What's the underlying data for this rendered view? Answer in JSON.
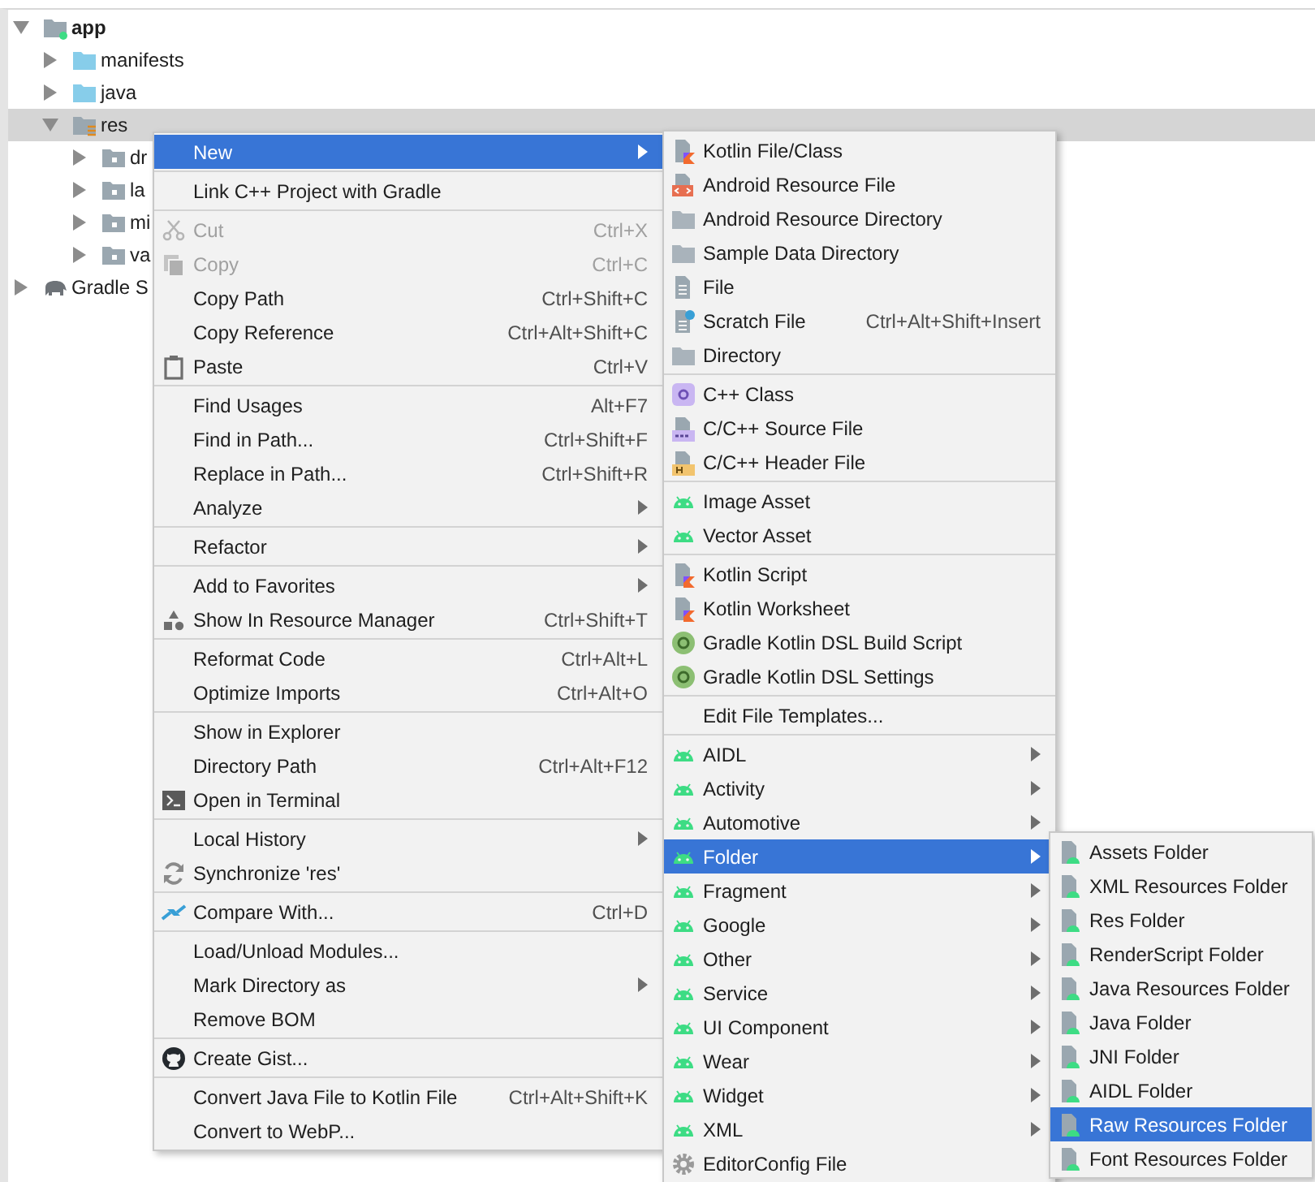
{
  "tree": [
    {
      "label": "app",
      "kind": "module",
      "expanded": true,
      "selected": false,
      "children": [
        {
          "label": "manifests",
          "kind": "source",
          "expanded": false,
          "selected": false
        },
        {
          "label": "java",
          "kind": "source",
          "expanded": false,
          "selected": false
        },
        {
          "label": "res",
          "kind": "resources",
          "expanded": true,
          "selected": true,
          "children": [
            {
              "label": "dr",
              "kind": "folder",
              "expanded": false,
              "selected": false
            },
            {
              "label": "la",
              "kind": "folder",
              "expanded": false,
              "selected": false
            },
            {
              "label": "mi",
              "kind": "folder",
              "expanded": false,
              "selected": false
            },
            {
              "label": "va",
              "kind": "folder",
              "expanded": false,
              "selected": false
            }
          ]
        }
      ]
    },
    {
      "label": "Gradle S",
      "kind": "gradle",
      "expanded": false,
      "selected": false
    }
  ],
  "menus": [
    {
      "items": [
        {
          "kind": "item",
          "label": "New",
          "submenu": true,
          "disabled": false,
          "selected": true
        },
        {
          "kind": "separator"
        },
        {
          "kind": "item",
          "label": "Link C++ Project with Gradle",
          "submenu": false,
          "disabled": false,
          "selected": false
        },
        {
          "kind": "separator"
        },
        {
          "kind": "item",
          "label": "Cut",
          "shortcut": "Ctrl+X",
          "submenu": false,
          "disabled": true,
          "selected": false
        },
        {
          "kind": "item",
          "label": "Copy",
          "shortcut": "Ctrl+C",
          "submenu": false,
          "disabled": true,
          "selected": false
        },
        {
          "kind": "item",
          "label": "Copy Path",
          "shortcut": "Ctrl+Shift+C",
          "submenu": false,
          "disabled": false,
          "selected": false
        },
        {
          "kind": "item",
          "label": "Copy Reference",
          "shortcut": "Ctrl+Alt+Shift+C",
          "submenu": false,
          "disabled": false,
          "selected": false
        },
        {
          "kind": "item",
          "label": "Paste",
          "shortcut": "Ctrl+V",
          "submenu": false,
          "disabled": false,
          "selected": false
        },
        {
          "kind": "separator"
        },
        {
          "kind": "item",
          "label": "Find Usages",
          "shortcut": "Alt+F7",
          "submenu": false,
          "disabled": false,
          "selected": false
        },
        {
          "kind": "item",
          "label": "Find in Path...",
          "shortcut": "Ctrl+Shift+F",
          "submenu": false,
          "disabled": false,
          "selected": false
        },
        {
          "kind": "item",
          "label": "Replace in Path...",
          "shortcut": "Ctrl+Shift+R",
          "submenu": false,
          "disabled": false,
          "selected": false
        },
        {
          "kind": "item",
          "label": "Analyze",
          "submenu": true,
          "disabled": false,
          "selected": false
        },
        {
          "kind": "separator"
        },
        {
          "kind": "item",
          "label": "Refactor",
          "submenu": true,
          "disabled": false,
          "selected": false
        },
        {
          "kind": "separator"
        },
        {
          "kind": "item",
          "label": "Add to Favorites",
          "submenu": true,
          "disabled": false,
          "selected": false
        },
        {
          "kind": "item",
          "label": "Show In Resource Manager",
          "shortcut": "Ctrl+Shift+T",
          "submenu": false,
          "disabled": false,
          "selected": false
        },
        {
          "kind": "separator"
        },
        {
          "kind": "item",
          "label": "Reformat Code",
          "shortcut": "Ctrl+Alt+L",
          "submenu": false,
          "disabled": false,
          "selected": false
        },
        {
          "kind": "item",
          "label": "Optimize Imports",
          "shortcut": "Ctrl+Alt+O",
          "submenu": false,
          "disabled": false,
          "selected": false
        },
        {
          "kind": "separator"
        },
        {
          "kind": "item",
          "label": "Show in Explorer",
          "submenu": false,
          "disabled": false,
          "selected": false
        },
        {
          "kind": "item",
          "label": "Directory Path",
          "shortcut": "Ctrl+Alt+F12",
          "submenu": false,
          "disabled": false,
          "selected": false
        },
        {
          "kind": "item",
          "label": "Open in Terminal",
          "submenu": false,
          "disabled": false,
          "selected": false
        },
        {
          "kind": "separator"
        },
        {
          "kind": "item",
          "label": "Local History",
          "submenu": true,
          "disabled": false,
          "selected": false
        },
        {
          "kind": "item",
          "label": "Synchronize 'res'",
          "submenu": false,
          "disabled": false,
          "selected": false
        },
        {
          "kind": "separator"
        },
        {
          "kind": "item",
          "label": "Compare With...",
          "shortcut": "Ctrl+D",
          "submenu": false,
          "disabled": false,
          "selected": false
        },
        {
          "kind": "separator"
        },
        {
          "kind": "item",
          "label": "Load/Unload Modules...",
          "submenu": false,
          "disabled": false,
          "selected": false
        },
        {
          "kind": "item",
          "label": "Mark Directory as",
          "submenu": true,
          "disabled": false,
          "selected": false
        },
        {
          "kind": "item",
          "label": "Remove BOM",
          "submenu": false,
          "disabled": false,
          "selected": false
        },
        {
          "kind": "separator"
        },
        {
          "kind": "item",
          "label": "Create Gist...",
          "submenu": false,
          "disabled": false,
          "selected": false
        },
        {
          "kind": "separator"
        },
        {
          "kind": "item",
          "label": "Convert Java File to Kotlin File",
          "shortcut": "Ctrl+Alt+Shift+K",
          "submenu": false,
          "disabled": false,
          "selected": false
        },
        {
          "kind": "item",
          "label": "Convert to WebP...",
          "submenu": false,
          "disabled": false,
          "selected": false
        }
      ]
    },
    {
      "items": [
        {
          "kind": "item",
          "label": "Kotlin File/Class",
          "submenu": false,
          "selected": false
        },
        {
          "kind": "item",
          "label": "Android Resource File",
          "submenu": false,
          "selected": false
        },
        {
          "kind": "item",
          "label": "Android Resource Directory",
          "submenu": false,
          "selected": false
        },
        {
          "kind": "item",
          "label": "Sample Data Directory",
          "submenu": false,
          "selected": false
        },
        {
          "kind": "item",
          "label": "File",
          "submenu": false,
          "selected": false
        },
        {
          "kind": "item",
          "label": "Scratch File",
          "shortcut": "Ctrl+Alt+Shift+Insert",
          "submenu": false,
          "selected": false
        },
        {
          "kind": "item",
          "label": "Directory",
          "submenu": false,
          "selected": false
        },
        {
          "kind": "separator"
        },
        {
          "kind": "item",
          "label": "C++ Class",
          "submenu": false,
          "selected": false
        },
        {
          "kind": "item",
          "label": "C/C++ Source File",
          "submenu": false,
          "selected": false
        },
        {
          "kind": "item",
          "label": "C/C++ Header File",
          "submenu": false,
          "selected": false
        },
        {
          "kind": "separator"
        },
        {
          "kind": "item",
          "label": "Image Asset",
          "submenu": false,
          "selected": false
        },
        {
          "kind": "item",
          "label": "Vector Asset",
          "submenu": false,
          "selected": false
        },
        {
          "kind": "separator"
        },
        {
          "kind": "item",
          "label": "Kotlin Script",
          "submenu": false,
          "selected": false
        },
        {
          "kind": "item",
          "label": "Kotlin Worksheet",
          "submenu": false,
          "selected": false
        },
        {
          "kind": "item",
          "label": "Gradle Kotlin DSL Build Script",
          "submenu": false,
          "selected": false
        },
        {
          "kind": "item",
          "label": "Gradle Kotlin DSL Settings",
          "submenu": false,
          "selected": false
        },
        {
          "kind": "separator"
        },
        {
          "kind": "item",
          "label": "Edit File Templates...",
          "submenu": false,
          "selected": false
        },
        {
          "kind": "separator"
        },
        {
          "kind": "item",
          "label": "AIDL",
          "submenu": true,
          "selected": false
        },
        {
          "kind": "item",
          "label": "Activity",
          "submenu": true,
          "selected": false
        },
        {
          "kind": "item",
          "label": "Automotive",
          "submenu": true,
          "selected": false
        },
        {
          "kind": "item",
          "label": "Folder",
          "submenu": true,
          "selected": true
        },
        {
          "kind": "item",
          "label": "Fragment",
          "submenu": true,
          "selected": false
        },
        {
          "kind": "item",
          "label": "Google",
          "submenu": true,
          "selected": false
        },
        {
          "kind": "item",
          "label": "Other",
          "submenu": true,
          "selected": false
        },
        {
          "kind": "item",
          "label": "Service",
          "submenu": true,
          "selected": false
        },
        {
          "kind": "item",
          "label": "UI Component",
          "submenu": true,
          "selected": false
        },
        {
          "kind": "item",
          "label": "Wear",
          "submenu": true,
          "selected": false
        },
        {
          "kind": "item",
          "label": "Widget",
          "submenu": true,
          "selected": false
        },
        {
          "kind": "item",
          "label": "XML",
          "submenu": true,
          "selected": false
        },
        {
          "kind": "item",
          "label": "EditorConfig File",
          "submenu": false,
          "selected": false
        }
      ]
    },
    {
      "items": [
        {
          "kind": "item",
          "label": "Assets Folder",
          "selected": false
        },
        {
          "kind": "item",
          "label": "XML Resources Folder",
          "selected": false
        },
        {
          "kind": "item",
          "label": "Res Folder",
          "selected": false
        },
        {
          "kind": "item",
          "label": "RenderScript Folder",
          "selected": false
        },
        {
          "kind": "item",
          "label": "Java Resources Folder",
          "selected": false
        },
        {
          "kind": "item",
          "label": "Java Folder",
          "selected": false
        },
        {
          "kind": "item",
          "label": "JNI Folder",
          "selected": false
        },
        {
          "kind": "item",
          "label": "AIDL Folder",
          "selected": false
        },
        {
          "kind": "item",
          "label": "Raw Resources Folder",
          "selected": true
        },
        {
          "kind": "item",
          "label": "Font Resources Folder",
          "selected": false
        }
      ]
    }
  ]
}
